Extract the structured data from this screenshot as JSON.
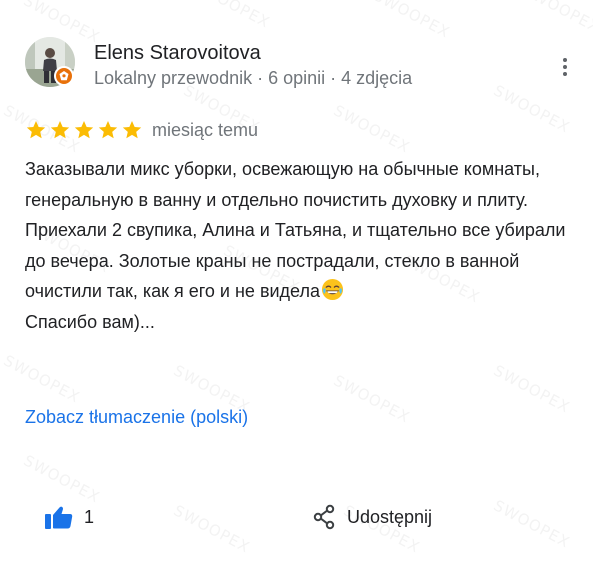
{
  "reviewer": {
    "name": "Elens Starovoitova",
    "meta": "Lokalny przewodnik · 6 opinii · 4 zdjęcia",
    "avatar_icon": "person-photo-avatar",
    "badge_icon": "local-guide-badge-icon"
  },
  "rating": {
    "stars": 5,
    "max_stars": 5,
    "date": "miesiąc temu",
    "star_color": "#fbbc04"
  },
  "review": {
    "text": "Заказывали микс уборки, освежающую на обычные комнаты, генеральную в ванну и отдельно почистить духовку и плиту. Приехали 2 свупика, Алина и Татьяна, и тщательно все убирали до вечера. Золотые краны не пострадали, стекло в ванной очистили так, как я его и не видела",
    "text_after_emoji": "Спасибо вам)...",
    "emoji": "rolling-on-the-floor-laughing-emoji"
  },
  "links": {
    "translate": "Zobacz tłumaczenie (polski)",
    "color": "#1a73e8"
  },
  "actions": {
    "like_icon": "thumbs-up-icon",
    "like_count": "1",
    "share_icon": "share-icon",
    "share_label": "Udostępnij"
  },
  "menu": {
    "icon": "more-vert-icon"
  },
  "watermark": {
    "text": "SWOOPEX"
  }
}
